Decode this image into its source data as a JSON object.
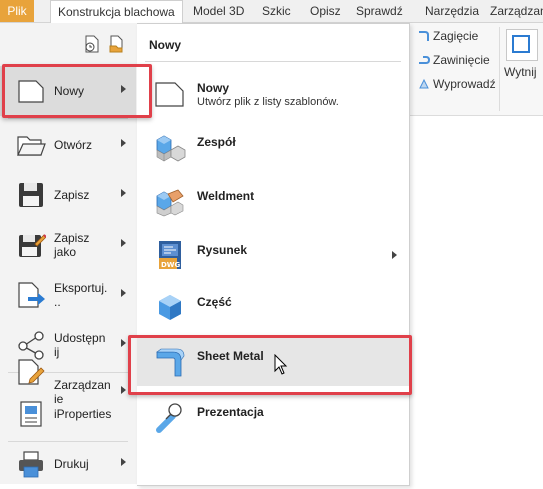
{
  "ribbon_tabs": [
    "Plik",
    "Konstrukcja blachowa",
    "Model 3D",
    "Szkic",
    "Opisz",
    "Sprawdź",
    "Narzędzia",
    "Zarządzan"
  ],
  "active_tab": "Konstrukcja blachowa",
  "ribbon_panel": {
    "items": [
      "Zagięcie",
      "Zawinięcie",
      "Wyprowadź"
    ],
    "big_button_label": "Wytnij"
  },
  "app_menu": {
    "items": [
      {
        "label": "Nowy",
        "icon": "new-document-icon",
        "has_submenu": true,
        "selected": true
      },
      {
        "label": "Otwórz",
        "icon": "open-folder-icon",
        "has_submenu": true
      },
      {
        "label": "Zapisz",
        "icon": "save-disk-icon",
        "has_submenu": true
      },
      {
        "label": "Zapisz jako",
        "icon": "save-as-icon",
        "has_submenu": true
      },
      {
        "label": "Eksportuj...",
        "icon": "export-icon",
        "has_submenu": true
      },
      {
        "label": "Udostępnij",
        "icon": "share-icon",
        "has_submenu": true
      },
      {
        "label": "Zarządzanie",
        "icon": "manage-icon",
        "has_submenu": true
      },
      {
        "label": "iProperties",
        "icon": "iproperties-icon",
        "has_submenu": false
      },
      {
        "label": "Drukuj",
        "icon": "printer-icon",
        "has_submenu": true
      }
    ],
    "display_labels": [
      "Nowy",
      "Otwórz",
      "Zapisz",
      "Zapisz\njako",
      "Eksportuj.\n..",
      "Udostępn\nij",
      "Zarządzan\nie",
      "iProperties",
      "Drukuj"
    ]
  },
  "submenu": {
    "title": "Nowy",
    "items": [
      {
        "label": "Nowy",
        "description": "Utwórz plik z listy szablonów.",
        "icon": "new-document-icon",
        "has_submenu": false
      },
      {
        "label": "Zespół",
        "description": "",
        "icon": "assembly-icon",
        "has_submenu": false
      },
      {
        "label": "Weldment",
        "description": "",
        "icon": "weldment-icon",
        "has_submenu": false
      },
      {
        "label": "Rysunek",
        "description": "",
        "icon": "drawing-dwg-icon",
        "has_submenu": true
      },
      {
        "label": "Część",
        "description": "",
        "icon": "part-cube-icon",
        "has_submenu": false
      },
      {
        "label": "Sheet Metal",
        "description": "",
        "icon": "sheet-metal-icon",
        "has_submenu": false,
        "hovered": true
      },
      {
        "label": "Prezentacja",
        "description": "",
        "icon": "presentation-icon",
        "has_submenu": false
      }
    ]
  },
  "colors": {
    "file_tab": "#e8a33b",
    "highlight": "#e0404a",
    "accent_blue": "#2b7bd1"
  }
}
